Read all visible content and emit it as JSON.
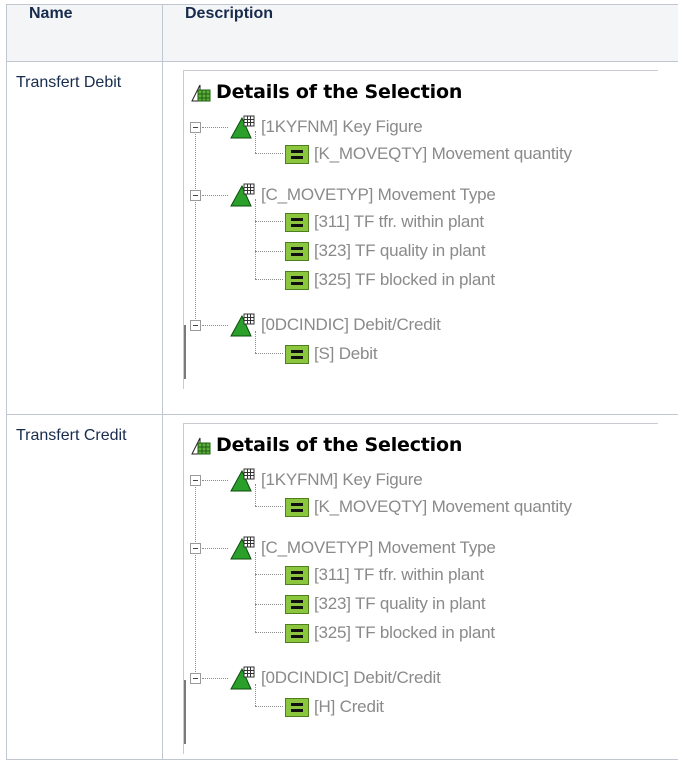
{
  "table": {
    "headers": {
      "name": "Name",
      "description": "Description"
    },
    "rows": [
      {
        "name": "Transfert Debit",
        "panel": {
          "title": "Details of the Selection",
          "nodes": [
            {
              "label": "[1KYFNM] Key Figure",
              "icon": "triangle-grid-icon"
            },
            {
              "label": "[K_MOVEQTY] Movement quantity",
              "icon": "equals-icon"
            },
            {
              "label": "[C_MOVETYP] Movement Type",
              "icon": "triangle-grid-icon"
            },
            {
              "label": "[311] TF tfr. within plant",
              "icon": "equals-icon"
            },
            {
              "label": "[323] TF quality in plant",
              "icon": "equals-icon"
            },
            {
              "label": "[325] TF blocked in plant",
              "icon": "equals-icon"
            },
            {
              "label": "[0DCINDIC] Debit/Credit",
              "icon": "triangle-grid-icon"
            },
            {
              "label": "[S] Debit",
              "icon": "equals-icon"
            }
          ]
        }
      },
      {
        "name": "Transfert Credit",
        "panel": {
          "title": "Details of the Selection",
          "nodes": [
            {
              "label": "[1KYFNM] Key Figure",
              "icon": "triangle-grid-icon"
            },
            {
              "label": "[K_MOVEQTY] Movement quantity",
              "icon": "equals-icon"
            },
            {
              "label": "[C_MOVETYP] Movement Type",
              "icon": "triangle-grid-icon"
            },
            {
              "label": "[311] TF tfr. within plant",
              "icon": "equals-icon"
            },
            {
              "label": "[323] TF quality in plant",
              "icon": "equals-icon"
            },
            {
              "label": "[325] TF blocked in plant",
              "icon": "equals-icon"
            },
            {
              "label": "[0DCINDIC] Debit/Credit",
              "icon": "triangle-grid-icon"
            },
            {
              "label": "[H] Credit",
              "icon": "equals-icon"
            }
          ]
        }
      }
    ]
  }
}
